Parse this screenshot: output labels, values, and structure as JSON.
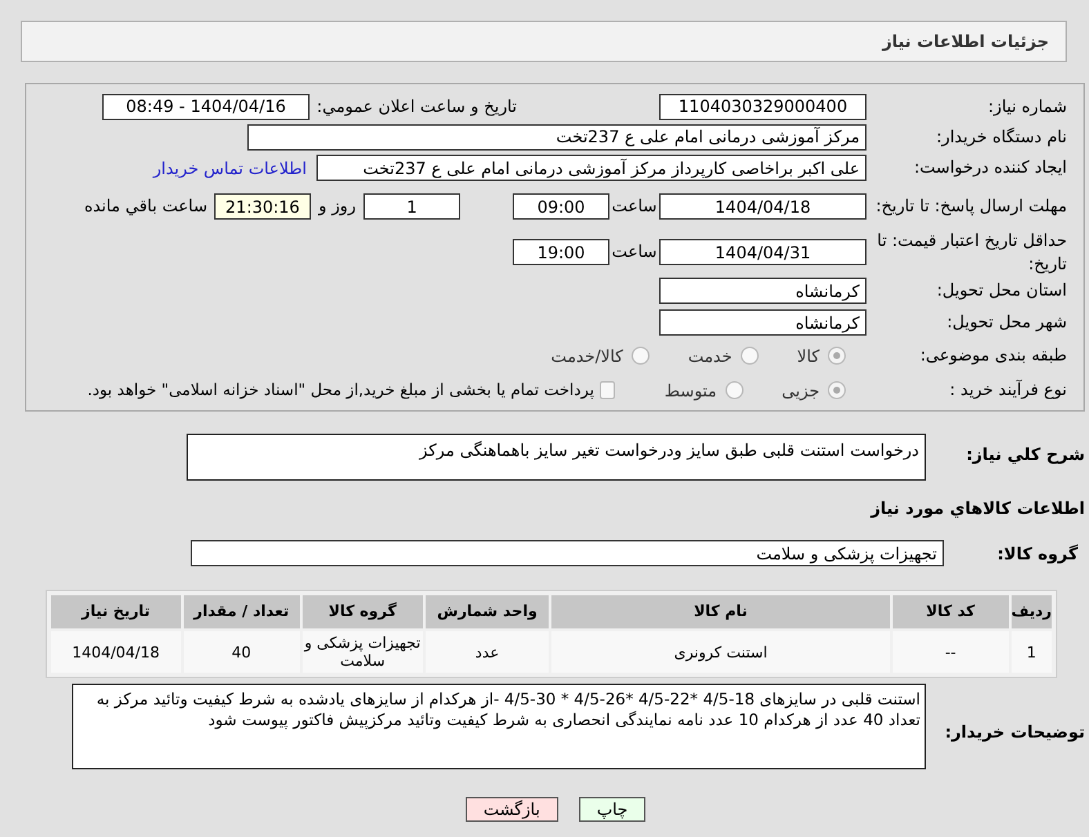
{
  "header": {
    "title": "جزئیات اطلاعات نیاز"
  },
  "need_number": {
    "label": "شماره نیاز:",
    "value": "1104030329000400"
  },
  "announce": {
    "label": "تاریخ و ساعت اعلان عمومي:",
    "value": "1404/04/16 - 08:49"
  },
  "buyer_org": {
    "label": "نام دستگاه خریدار:",
    "value": "مرکز آموزشی درمانی امام علی ع 237تخت"
  },
  "creator": {
    "label": "ایجاد کننده درخواست:",
    "value": "علی اکبر براخاصی کارپرداز  مرکز آموزشی درمانی امام علی ع 237تخت",
    "link": "اطلاعات تماس خریدار"
  },
  "reply_deadline": {
    "label": "مهلت ارسال پاسخ: تا تاریخ:",
    "date": "1404/04/18",
    "time_label": "ساعت",
    "time": "09:00",
    "days": "1",
    "days_label": "روز و",
    "remaining": "21:30:16",
    "remaining_label": "ساعت باقي مانده"
  },
  "price_validity": {
    "label": "حداقل تاریخ اعتبار قیمت: تا تاریخ:",
    "date": "1404/04/31",
    "time_label": "ساعت",
    "time": "19:00"
  },
  "province": {
    "label": "استان محل تحویل:",
    "value": "کرمانشاه"
  },
  "city": {
    "label": "شهر محل تحویل:",
    "value": "کرمانشاه"
  },
  "category": {
    "label": "طبقه بندی موضوعی:",
    "options": [
      {
        "label": "کالا",
        "selected": true
      },
      {
        "label": "خدمت",
        "selected": false
      },
      {
        "label": "کالا/خدمت",
        "selected": false
      }
    ]
  },
  "process": {
    "label": "نوع فرآیند خرید :",
    "options": [
      {
        "label": "جزیی",
        "selected": true
      },
      {
        "label": "متوسط",
        "selected": false
      }
    ],
    "treasury": {
      "label": "پرداخت تمام یا بخشی از مبلغ خرید,از محل \"اسناد خزانه اسلامی\" خواهد بود.",
      "checked": false
    }
  },
  "summary": {
    "label": "شرح کلي نیاز:",
    "value": "درخواست استنت قلبی طبق سایز ودرخواست تغیر سایز باهماهنگی مرکز"
  },
  "goods_heading": "اطلاعات کالاهاي مورد نیاز",
  "goods_group": {
    "label": "گروه کالا:",
    "value": "تجهیزات پزشکی و سلامت"
  },
  "table": {
    "columns": [
      "ردیف",
      "کد کالا",
      "نام کالا",
      "واحد شمارش",
      "گروه کالا",
      "تعداد / مقدار",
      "تاریخ نیاز"
    ],
    "rows": [
      [
        "1",
        "--",
        "استنت کرونری",
        "عدد",
        "تجهیزات پزشکی و سلامت",
        "40",
        "1404/04/18"
      ]
    ]
  },
  "buyer_notes": {
    "label": "توضیحات خریدار:",
    "value": "استنت قلبی در سایزهای 18-4/5 *22-4/5 *26-4/5 * 30-4/5 -از هرکدام از سایزهای یادشده به شرط کیفیت وتائید مرکز به تعداد 40 عدد از هرکدام 10 عدد نامه نمایندگی انحصاری به شرط کیفیت وتائید مرکزپیش فاکتور پیوست شود"
  },
  "buttons": [
    {
      "label": "چاپ",
      "kind": "print"
    },
    {
      "label": "بازگشت",
      "kind": "back"
    }
  ]
}
